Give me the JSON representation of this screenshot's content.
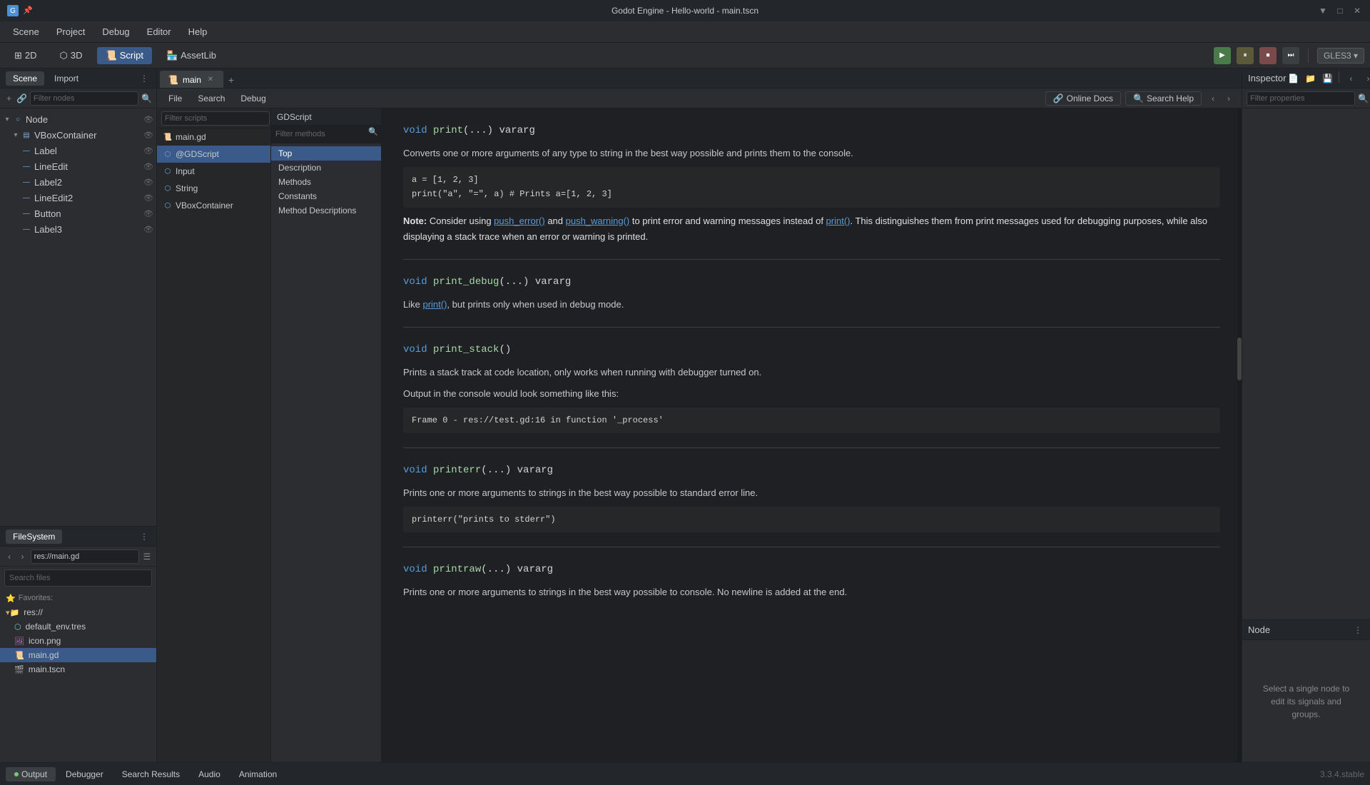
{
  "titlebar": {
    "title": "Godot Engine - Hello-world - main.tscn",
    "controls": [
      "▼",
      "□",
      "✕"
    ]
  },
  "menubar": {
    "items": [
      "Scene",
      "Project",
      "Debug",
      "Editor",
      "Help"
    ]
  },
  "toolbar": {
    "view2d": "2D",
    "view3d": "3D",
    "script": "Script",
    "assetlib": "AssetLib",
    "gles": "GLES3 ▾"
  },
  "left_panel": {
    "scene_tab": "Scene",
    "import_tab": "Import",
    "filter_placeholder": "Filter nodes",
    "tree": [
      {
        "label": "Node",
        "level": 0,
        "type": "node",
        "has_script": false
      },
      {
        "label": "VBoxContainer",
        "level": 1,
        "type": "vbox",
        "has_script": false
      },
      {
        "label": "Label",
        "level": 2,
        "type": "label",
        "has_script": false
      },
      {
        "label": "LineEdit",
        "level": 2,
        "type": "lineedit",
        "has_script": false
      },
      {
        "label": "Label2",
        "level": 2,
        "type": "label",
        "has_script": false
      },
      {
        "label": "LineEdit2",
        "level": 2,
        "type": "lineedit",
        "has_script": false
      },
      {
        "label": "Button",
        "level": 2,
        "type": "button",
        "has_script": false
      },
      {
        "label": "Label3",
        "level": 2,
        "type": "label",
        "has_script": false
      }
    ]
  },
  "filesystem": {
    "title": "FileSystem",
    "path": "res://main.gd",
    "search_placeholder": "Search files",
    "favorites_label": "⭐ Favorites:",
    "items": [
      {
        "label": "res://",
        "type": "folder",
        "level": 0
      },
      {
        "label": "default_env.tres",
        "type": "tres",
        "level": 1
      },
      {
        "label": "icon.png",
        "type": "png",
        "level": 1
      },
      {
        "label": "main.gd",
        "type": "gd",
        "level": 1,
        "selected": true
      },
      {
        "label": "main.tscn",
        "type": "tscn",
        "level": 1
      }
    ]
  },
  "script_panel": {
    "tabs": [
      {
        "label": "main",
        "active": true
      }
    ],
    "menu_items": [
      "File",
      "Search",
      "Debug"
    ],
    "online_docs": "Online Docs",
    "search_help": "Search Help",
    "filter_scripts_placeholder": "Filter scripts",
    "scripts_list": [
      {
        "label": "main.gd",
        "active": false
      },
      {
        "label": "@GDScript",
        "active": true
      },
      {
        "label": "Input",
        "active": false
      },
      {
        "label": "String",
        "active": false
      },
      {
        "label": "VBoxContainer",
        "active": false
      }
    ]
  },
  "gdscript": {
    "title": "GDScript",
    "filter_placeholder": "Filter methods",
    "methods": [
      "Top",
      "Description",
      "Methods",
      "Constants",
      "Method Descriptions"
    ]
  },
  "help_content": {
    "functions": [
      {
        "signature": "void print(...) vararg",
        "description": "Converts one or more arguments of any type to string in the best way possible and prints them to the console.",
        "code": "a = [1, 2, 3]\nprint(\"a\", \"=\", a) # Prints a=[1, 2, 3]",
        "note": "Note: Consider using push_error() and push_warning() to print error and warning messages instead of print(). This distinguishes them from print messages used for debugging purposes, while also displaying a stack trace when an error or warning is printed."
      },
      {
        "signature": "void print_debug(...) vararg",
        "description": "Like print(), but prints only when used in debug mode.",
        "code": null,
        "note": null
      },
      {
        "signature": "void print_stack()",
        "description": "Prints a stack track at code location, only works when running with debugger turned on.",
        "code": "Output in the console would look something like this:\n\nFrame 0 - res://test.gd:16 in function '_process'",
        "note": null
      },
      {
        "signature": "void printerr(...) vararg",
        "description": "Prints one or more arguments to strings in the best way possible to standard error line.",
        "code": "printerr(\"prints to stderr\")",
        "note": null
      },
      {
        "signature": "void printraw(...) vararg",
        "description": "Prints one or more arguments to strings in the best way possible to console. No newline is added at the end.",
        "code": null,
        "note": null
      }
    ]
  },
  "inspector": {
    "title": "Inspector",
    "filter_placeholder": "Filter properties",
    "nav_back": "‹",
    "nav_forward": "›",
    "node_title": "Node",
    "hint_text": "Select a single node to edit its signals and groups."
  },
  "bottom_bar": {
    "tabs": [
      "Output",
      "Debugger",
      "Search Results",
      "Audio",
      "Animation"
    ],
    "version": "3.3.4.stable",
    "output_active": true
  }
}
